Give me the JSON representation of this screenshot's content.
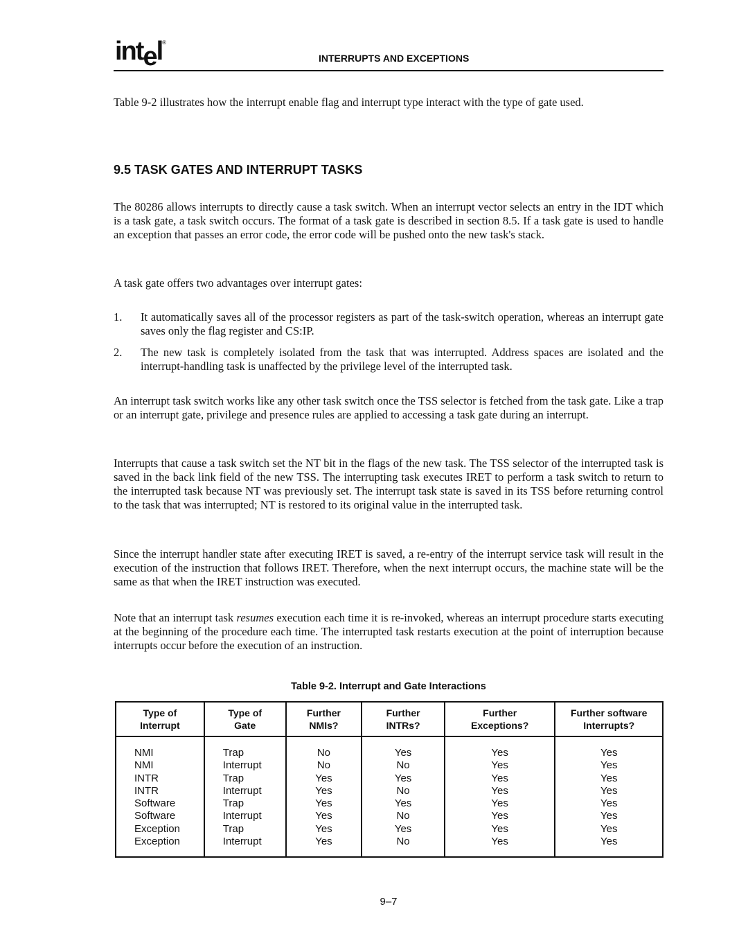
{
  "header": {
    "logo_text": "int",
    "logo_e": "e",
    "logo_l": "l",
    "logo_mark": "®",
    "running_head": "INTERRUPTS AND EXCEPTIONS"
  },
  "intro": "Table 9-2 illustrates how the interrupt enable flag and interrupt type interact with the type of gate used.",
  "section": {
    "heading": "9.5 TASK GATES AND INTERRUPT TASKS",
    "p1": "The 80286 allows interrupts to directly cause a task switch. When an interrupt vector selects an entry in the IDT which is a task gate, a task switch occurs. The format of a task gate is described in section 8.5. If a task gate is used to handle an exception that passes an error code, the error code will be pushed onto the new task's stack.",
    "p2": "A task gate offers two advantages over interrupt gates:",
    "list": [
      {
        "num": "1.",
        "text": "It automatically saves all of the processor registers as part of the task-switch operation, whereas an interrupt gate saves only the flag register and CS:IP."
      },
      {
        "num": "2.",
        "text": "The new task is completely isolated from the task that was interrupted. Address spaces are isolated and the interrupt-handling task is unaffected by the privilege level of the interrupted task."
      }
    ],
    "p3": "An interrupt task switch works like any other task switch once the TSS selector is fetched from the task gate. Like a trap or an interrupt gate, privilege and presence rules are applied to accessing a task gate during an interrupt.",
    "p4": "Interrupts that cause a task switch set the NT bit in the flags of the new task. The TSS selector of the interrupted task is saved in the back link field of the new TSS. The interrupting task executes IRET to perform a task switch to return to the interrupted task because NT was previously set. The interrupt task state is saved in its TSS before returning control to the task that was interrupted; NT is restored to its original value in the interrupted task.",
    "p5": "Since the interrupt handler state after executing IRET is saved, a re-entry of the interrupt service task will result in the execution of the instruction that follows IRET. Therefore, when the next interrupt occurs, the machine state will be the same as that when the IRET instruction was executed.",
    "p6_before": "Note that an interrupt task ",
    "p6_em": "resumes",
    "p6_after": " execution each time it is re-invoked, whereas an interrupt procedure starts executing at the beginning of the procedure each time. The interrupted task restarts execution at the point of interruption because interrupts occur before the execution of an instruction."
  },
  "table": {
    "caption": "Table 9-2.  Interrupt and Gate Interactions",
    "headers": [
      [
        "Type of",
        "Interrupt"
      ],
      [
        "Type of",
        "Gate"
      ],
      [
        "Further",
        "NMIs?"
      ],
      [
        "Further",
        "INTRs?"
      ],
      [
        "Further",
        "Exceptions?"
      ],
      [
        "Further software",
        "Interrupts?"
      ]
    ],
    "rows": [
      [
        "NMI",
        "Trap",
        "No",
        "Yes",
        "Yes",
        "Yes"
      ],
      [
        "NMI",
        "Interrupt",
        "No",
        "No",
        "Yes",
        "Yes"
      ],
      [
        "INTR",
        "Trap",
        "Yes",
        "Yes",
        "Yes",
        "Yes"
      ],
      [
        "INTR",
        "Interrupt",
        "Yes",
        "No",
        "Yes",
        "Yes"
      ],
      [
        "Software",
        "Trap",
        "Yes",
        "Yes",
        "Yes",
        "Yes"
      ],
      [
        "Software",
        "Interrupt",
        "Yes",
        "No",
        "Yes",
        "Yes"
      ],
      [
        "Exception",
        "Trap",
        "Yes",
        "Yes",
        "Yes",
        "Yes"
      ],
      [
        "Exception",
        "Interrupt",
        "Yes",
        "No",
        "Yes",
        "Yes"
      ]
    ]
  },
  "footer": {
    "page_number": "9–7"
  }
}
